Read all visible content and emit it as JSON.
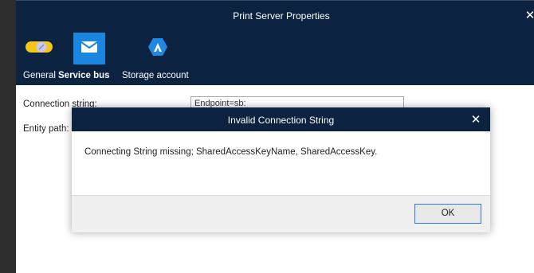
{
  "window": {
    "title": "Print Server Properties",
    "close_symbol": "✕"
  },
  "tabs": [
    {
      "label": "General",
      "icon": "toggle-icon",
      "selected": false
    },
    {
      "label": "Service bus",
      "icon": "mail-icon",
      "selected": true
    },
    {
      "label": "Storage account",
      "icon": "azure-icon",
      "selected": false
    }
  ],
  "form": {
    "connection_string_label": "Connection string:",
    "connection_string_value": "Endpoint=sb:",
    "entity_path_label": "Entity path:"
  },
  "dialog": {
    "title": "Invalid Connection String",
    "close_symbol": "✕",
    "message": "Connecting String missing; SharedAccessKeyName, SharedAccessKey.",
    "ok_label": "OK"
  },
  "colors": {
    "header_bg": "#0b2340",
    "accent": "#1a86e0",
    "toggle_yellow": "#f5c518"
  }
}
